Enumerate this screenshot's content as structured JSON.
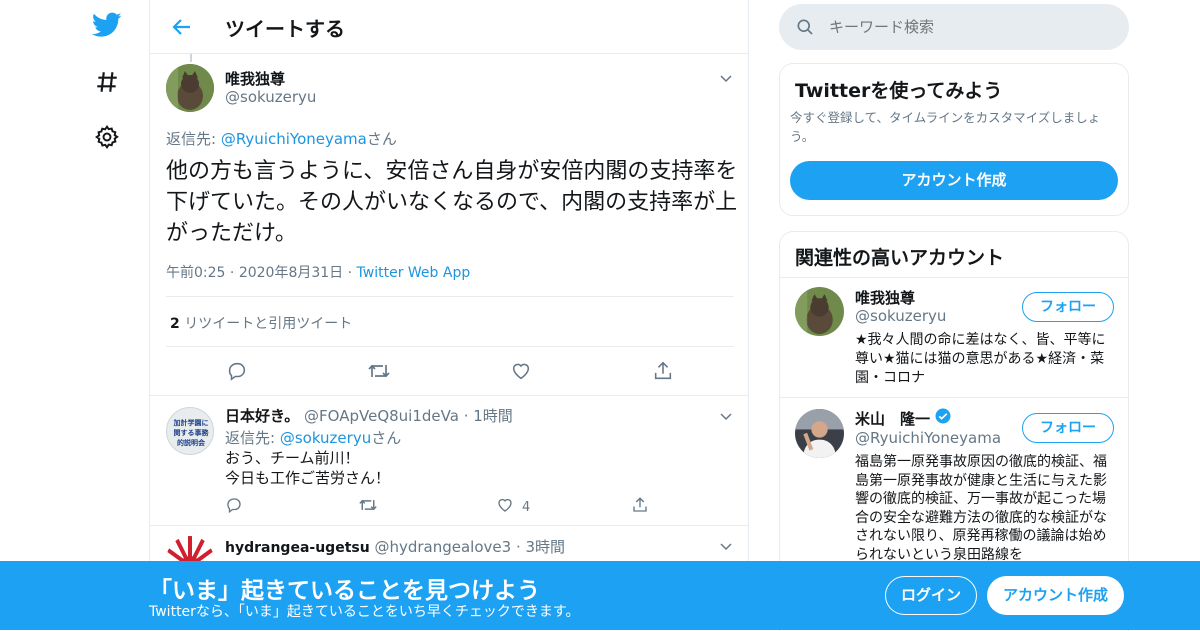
{
  "header": {
    "title": "ツイートする"
  },
  "tweet": {
    "name": "唯我独尊",
    "handle": "@sokuzeryu",
    "reply_prefix": "返信先: ",
    "reply_to": "@RyuichiYoneyama",
    "reply_suffix": "さん",
    "text": "他の方も言うように、安倍さん自身が安倍内閣の支持率を下げていた。その人がいなくなるので、内閣の支持率が上がっただけ。",
    "time": "午前0:25",
    "date": "2020年8月31日",
    "client": "Twitter Web App",
    "retweet_count": "2",
    "retweet_label": "リツイートと引用ツイート"
  },
  "replies": [
    {
      "name": "日本好き。",
      "handle": "@FOApVeQ8ui1deVa",
      "time": "1時間",
      "reply_prefix": "返信先: ",
      "reply_to": "@sokuzeryu",
      "reply_suffix": "さん",
      "line1": "おう、チーム前川！",
      "line2": "今日も工作ご苦労さん！",
      "likes": "4",
      "avatar_text": "加計学園に関する事務的説明会"
    },
    {
      "name": "hydrangea-ugetsu",
      "handle": "@hydrangealove3",
      "time": "3時間"
    }
  ],
  "sidebar": {
    "search_placeholder": "キーワード検索",
    "try_title": "Twitterを使ってみよう",
    "try_desc": "今すぐ登録して、タイムラインをカスタマイズしましょう。",
    "signup_button": "アカウント作成",
    "related_title": "関連性の高いアカウント",
    "accounts": [
      {
        "name": "唯我独尊",
        "handle": "@sokuzeryu",
        "follow": "フォロー",
        "bio": "★我々人間の命に差はなく、皆、平等に尊い★猫には猫の意思がある★経済・菜園・コロナ",
        "verified": false
      },
      {
        "name": "米山　隆一",
        "handle": "@RyuichiYoneyama",
        "follow": "フォロー",
        "bio": "福島第一原発事故原因の徹底的検証、福島第一原発事故が健康と生活に与えた影響の徹底的検証、万一事故が起こった場合の安全な避難方法の徹底的な検証がなされない限り、原発再稼働の議論は始められないという泉田路線を",
        "verified": true
      }
    ]
  },
  "banner": {
    "title": "「いま」起きていることを見つけよう",
    "subtitle": "Twitterなら、「いま」起きていることをいち早くチェックできます。",
    "login": "ログイン",
    "signup": "アカウント作成"
  },
  "colors": {
    "accent": "#1da1f2",
    "link": "#1b95e0",
    "border": "#e6ecf0",
    "secondary": "#657786"
  }
}
